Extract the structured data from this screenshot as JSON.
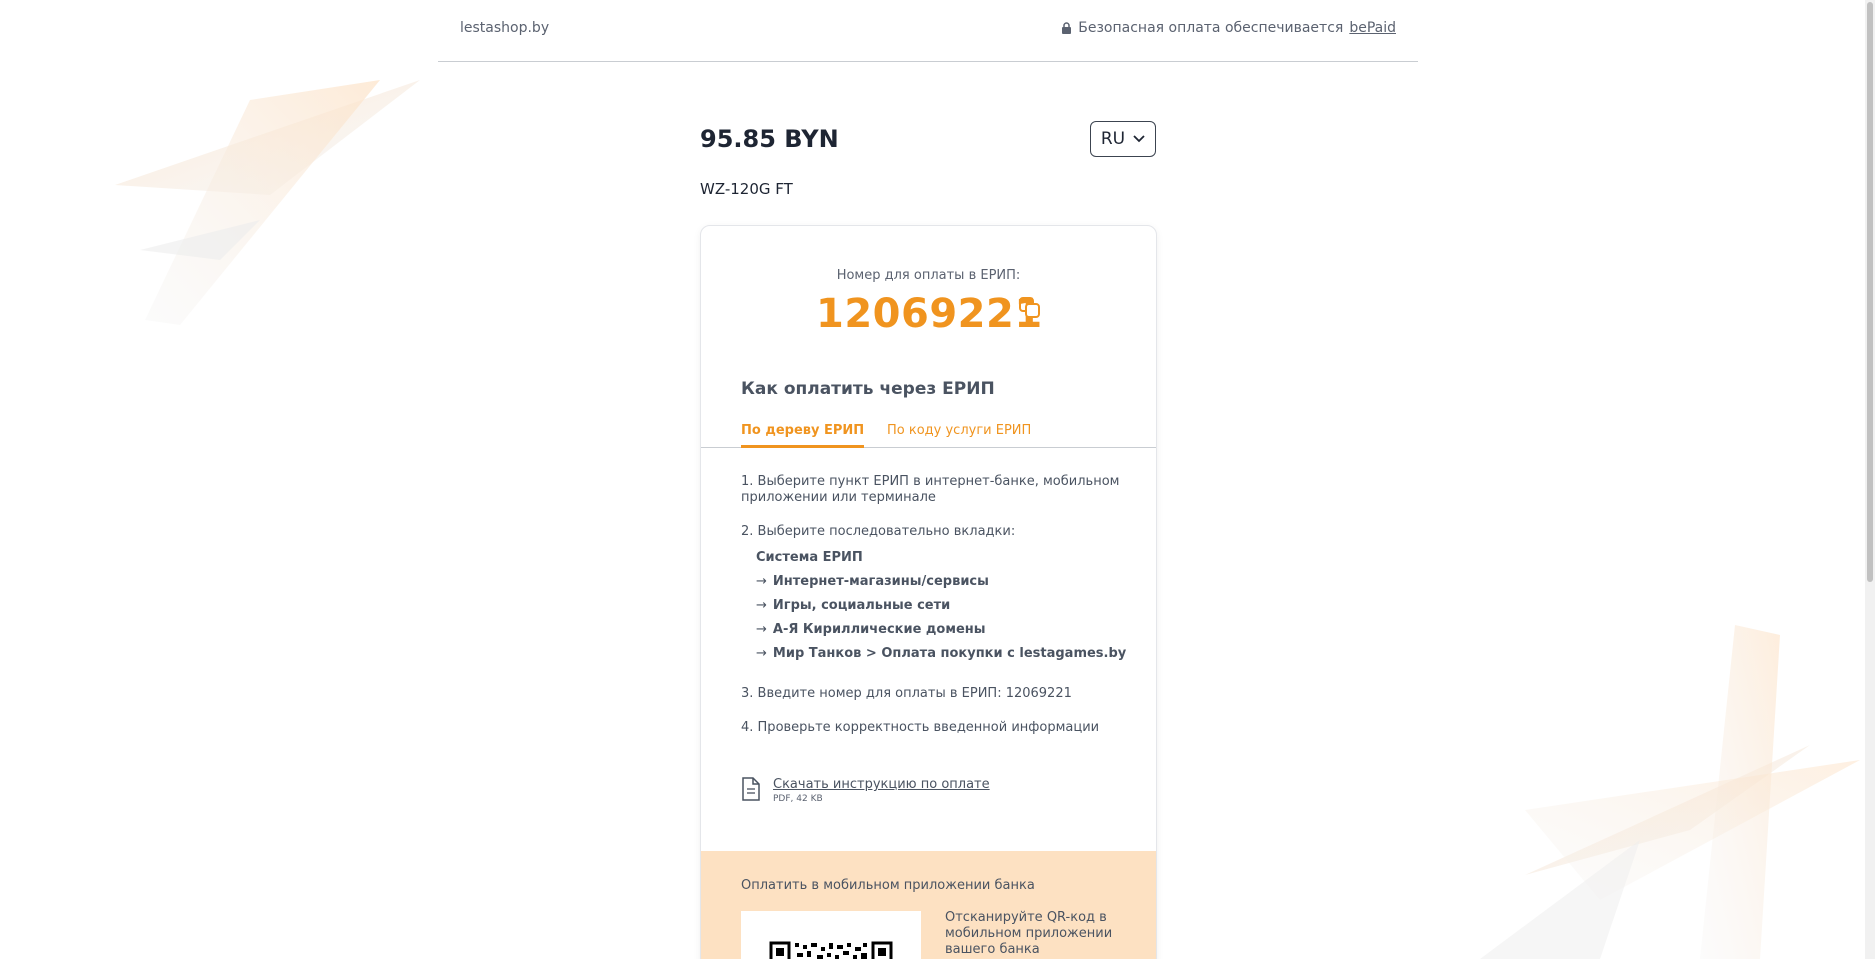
{
  "header": {
    "shop_name": "lestashop.by",
    "secure_text": "Безопасная оплата обеспечивается",
    "provider": "bePaid"
  },
  "payment": {
    "amount": "95.85 BYN",
    "product": "WZ-120G FT",
    "language": "RU"
  },
  "erip": {
    "code_label": "Номер для оплаты в ЕРИП:",
    "code": "12069221",
    "how_title": "Как оплатить через ЕРИП",
    "tabs": [
      {
        "label": "По дереву ЕРИП",
        "active": true
      },
      {
        "label": "По коду услуги ЕРИП",
        "active": false
      }
    ],
    "steps": {
      "step1": "1. Выберите пункт ЕРИП в интернет-банке, мобильном приложении или терминале",
      "step2": "2. Выберите последовательно вкладки:",
      "tree_root": "Система ЕРИП",
      "tree_items": [
        "Интернет-магазины/сервисы",
        "Игры, социальные сети",
        "А-Я Кириллические домены",
        "Мир Танков > Оплата покупки с lestagames.by"
      ],
      "step3": "3. Введите номер для оплаты в ЕРИП: 12069221",
      "step4": "4. Проверьте корректность введенной информации"
    },
    "download": {
      "label": "Скачать инструкцию по оплате",
      "meta": "PDF, 42 KB"
    }
  },
  "bank": {
    "title": "Оплатить в мобильном приложении банка",
    "qr_hint": "Отсканируйте QR-код в мобильном приложении вашего банка"
  },
  "colors": {
    "accent": "#f0941f",
    "bank_bg": "#fde1c2",
    "text": "#4a5361"
  }
}
